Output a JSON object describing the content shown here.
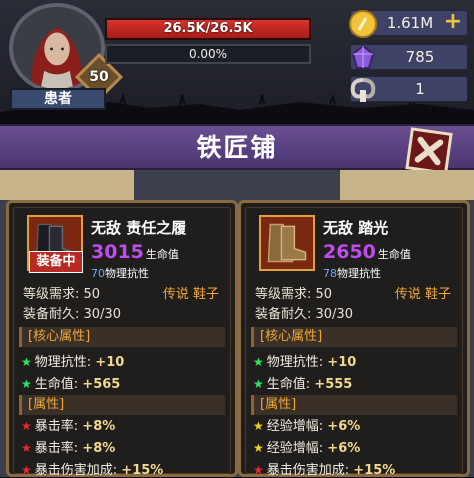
{
  "player": {
    "name": "患者",
    "level": "50",
    "hp_text": "26.5K/26.5K",
    "hp_fraction": 1.0,
    "xp_text": "0.00%",
    "xp_fraction": 0.0
  },
  "currency": {
    "gold": "1.61M",
    "gems": "785",
    "keys": "1"
  },
  "shop": {
    "title": "铁匠铺"
  },
  "cards": [
    {
      "name": "无敌 责任之履",
      "hp_value": "3015",
      "hp_unit": "生命值",
      "phys_value": "70",
      "phys_unit": "物理抗性",
      "equipped_label": "装备中",
      "level_req": "等级需求: 50",
      "durability": "装备耐久: 30/30",
      "rarity": "传说 鞋子",
      "core_header": "[核心属性]",
      "core_stats": [
        {
          "label": "物理抗性:",
          "value": "+10"
        },
        {
          "label": "生命值:",
          "value": "+565"
        }
      ],
      "attr_header": "[属性]",
      "attr_stats": [
        {
          "label": "暴击率:",
          "value": "+8%"
        },
        {
          "label": "暴击率:",
          "value": "+8%"
        },
        {
          "label": "暴击伤害加成:",
          "value": "+15%"
        }
      ]
    },
    {
      "name": "无敌 踏光",
      "hp_value": "2650",
      "hp_unit": "生命值",
      "phys_value": "78",
      "phys_unit": "物理抗性",
      "level_req": "等级需求: 50",
      "durability": "装备耐久: 30/30",
      "rarity": "传说 鞋子",
      "core_header": "[核心属性]",
      "core_stats": [
        {
          "label": "物理抗性:",
          "value": "+10"
        },
        {
          "label": "生命值:",
          "value": "+555"
        }
      ],
      "attr_header": "[属性]",
      "attr_stats": [
        {
          "label": "经验增幅:",
          "value": "+6%"
        },
        {
          "label": "经验增幅:",
          "value": "+6%"
        },
        {
          "label": "暴击伤害加成:",
          "value": "+15%"
        }
      ]
    }
  ],
  "colors": {
    "hp_bar": "#d8342c",
    "title_bar": "#6a4f92",
    "rarity": "#f0a838",
    "hp_purple": "#c04cf0",
    "star_green": "#2ee860",
    "star_red": "#e82a2a",
    "star_yellow": "#f0d020"
  },
  "icons": {
    "gold": "gold-coin-icon",
    "gems": "purple-gem-icon",
    "keys": "ram-horn-key-icon",
    "close": "close-x-icon"
  }
}
